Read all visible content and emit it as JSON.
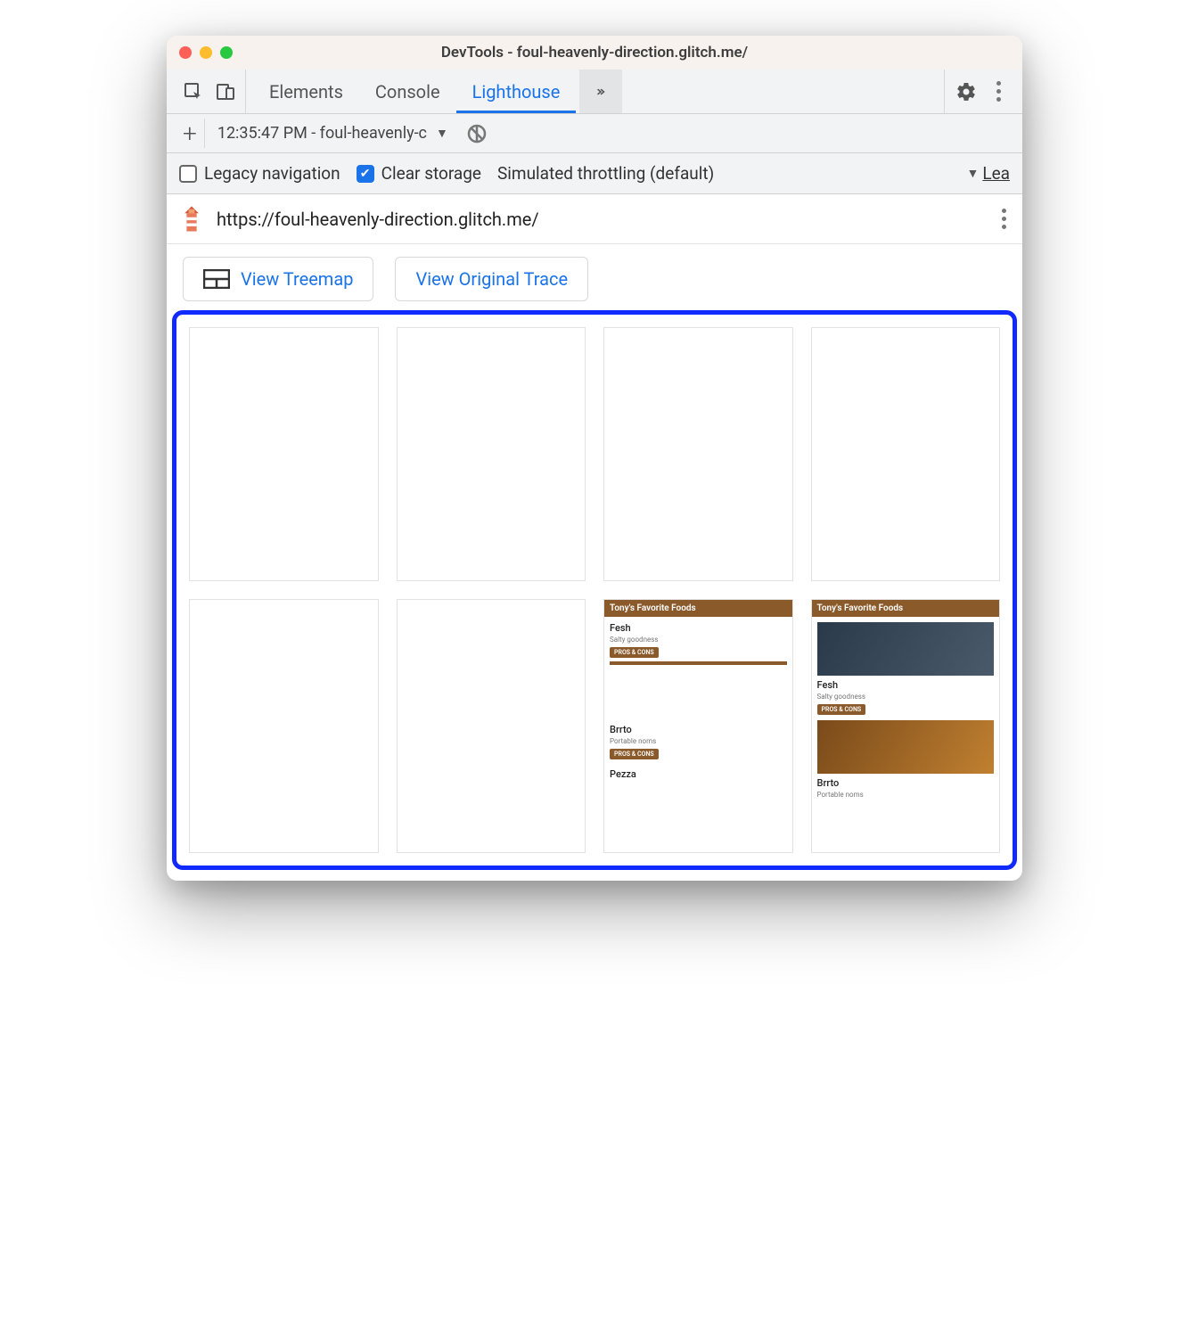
{
  "window": {
    "title": "DevTools - foul-heavenly-direction.glitch.me/"
  },
  "tabs": {
    "elements": "Elements",
    "console": "Console",
    "lighthouse": "Lighthouse"
  },
  "audit": {
    "name": "12:35:47 PM - foul-heavenly-c"
  },
  "options": {
    "legacy_label": "Legacy navigation",
    "clear_label": "Clear storage",
    "throttling_label": "Simulated throttling (default)",
    "learn_more": "Lea"
  },
  "report": {
    "url": "https://foul-heavenly-direction.glitch.me/"
  },
  "buttons": {
    "view_treemap": "View Treemap",
    "view_trace": "View Original Trace"
  },
  "filmstrip": {
    "frame7": {
      "header": "Tony's Favorite Foods",
      "items": [
        {
          "name": "Fesh",
          "sub": "Salty goodness",
          "tag": "PROS & CONS"
        },
        {
          "name": "Brrto",
          "sub": "Portable noms",
          "tag": "PROS & CONS"
        },
        {
          "name": "Pezza",
          "sub": "",
          "tag": ""
        }
      ]
    },
    "frame8": {
      "header": "Tony's Favorite Foods",
      "items": [
        {
          "name": "Fesh",
          "sub": "Salty goodness",
          "tag": "PROS & CONS"
        },
        {
          "name": "Brrto",
          "sub": "Portable noms",
          "tag": ""
        }
      ]
    }
  }
}
